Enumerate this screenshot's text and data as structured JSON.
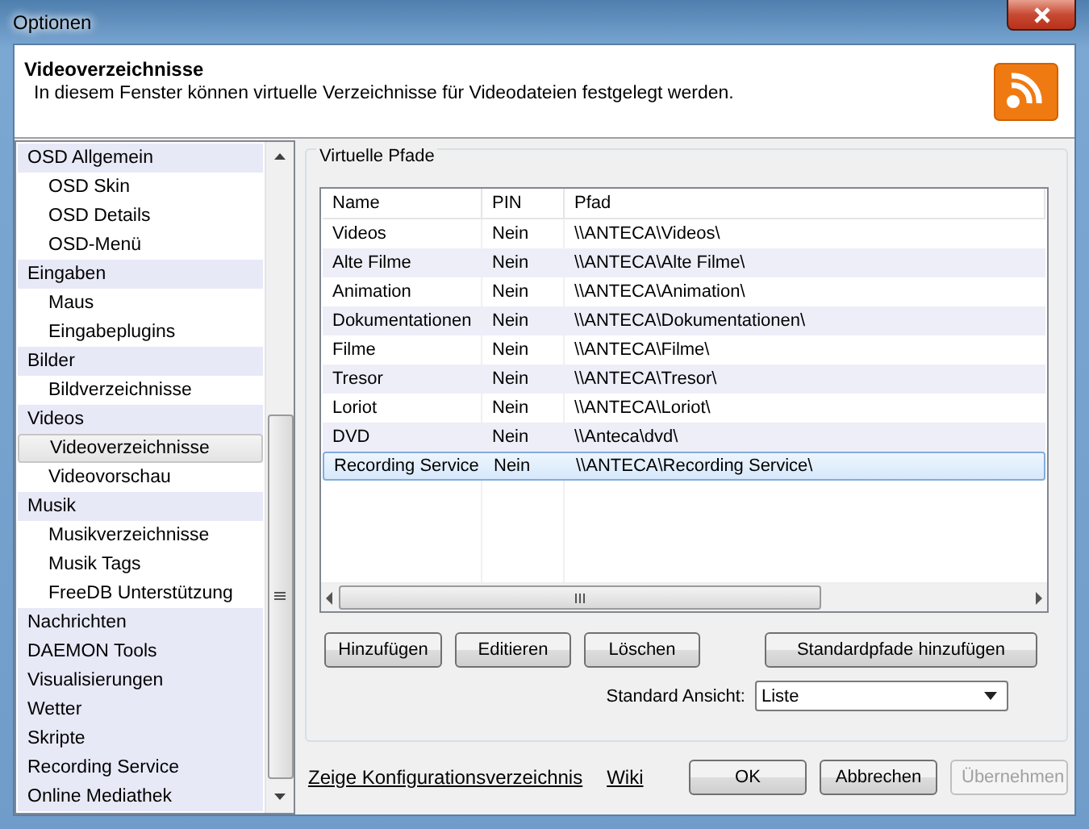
{
  "window": {
    "title": "Optionen"
  },
  "header": {
    "title": "Videoverzeichnisse",
    "description": "In diesem Fenster können virtuelle Verzeichnisse für Videodateien festgelegt werden."
  },
  "sidebar": {
    "items": [
      {
        "label": "OSD Allgemein",
        "selected": false,
        "children": [
          {
            "label": "OSD Skin",
            "selected": false
          },
          {
            "label": "OSD Details",
            "selected": false
          },
          {
            "label": "OSD-Menü",
            "selected": false
          }
        ]
      },
      {
        "label": "Eingaben",
        "selected": false,
        "children": [
          {
            "label": "Maus",
            "selected": false
          },
          {
            "label": "Eingabeplugins",
            "selected": false
          }
        ]
      },
      {
        "label": "Bilder",
        "selected": false,
        "children": [
          {
            "label": "Bildverzeichnisse",
            "selected": false
          }
        ]
      },
      {
        "label": "Videos",
        "selected": false,
        "children": [
          {
            "label": "Videoverzeichnisse",
            "selected": true
          },
          {
            "label": "Videovorschau",
            "selected": false
          }
        ]
      },
      {
        "label": "Musik",
        "selected": false,
        "children": [
          {
            "label": "Musikverzeichnisse",
            "selected": false
          },
          {
            "label": "Musik Tags",
            "selected": false
          },
          {
            "label": "FreeDB Unterstützung",
            "selected": false
          }
        ]
      },
      {
        "label": "Nachrichten",
        "selected": false
      },
      {
        "label": "DAEMON Tools",
        "selected": false
      },
      {
        "label": "Visualisierungen",
        "selected": false
      },
      {
        "label": "Wetter",
        "selected": false
      },
      {
        "label": "Skripte",
        "selected": false
      },
      {
        "label": "Recording Service",
        "selected": false
      },
      {
        "label": "Online Mediathek",
        "selected": false
      }
    ]
  },
  "group": {
    "title": "Virtuelle Pfade",
    "table": {
      "columns": [
        "Name",
        "PIN",
        "Pfad"
      ],
      "rows": [
        {
          "cells": [
            "Videos",
            "Nein",
            "\\\\ANTECA\\Videos\\"
          ],
          "selected": false
        },
        {
          "cells": [
            "Alte Filme",
            "Nein",
            "\\\\ANTECA\\Alte Filme\\"
          ],
          "selected": false
        },
        {
          "cells": [
            "Animation",
            "Nein",
            "\\\\ANTECA\\Animation\\"
          ],
          "selected": false
        },
        {
          "cells": [
            "Dokumentationen",
            "Nein",
            "\\\\ANTECA\\Dokumentationen\\"
          ],
          "selected": false
        },
        {
          "cells": [
            "Filme",
            "Nein",
            "\\\\ANTECA\\Filme\\"
          ],
          "selected": false
        },
        {
          "cells": [
            "Tresor",
            "Nein",
            "\\\\ANTECA\\Tresor\\"
          ],
          "selected": false
        },
        {
          "cells": [
            "Loriot",
            "Nein",
            "\\\\ANTECA\\Loriot\\"
          ],
          "selected": false
        },
        {
          "cells": [
            "DVD",
            "Nein",
            "\\\\Anteca\\dvd\\"
          ],
          "selected": false
        },
        {
          "cells": [
            "Recording Service",
            "Nein",
            "\\\\ANTECA\\Recording Service\\"
          ],
          "selected": true
        }
      ]
    },
    "buttons": [
      "Hinzufügen",
      "Editieren",
      "Löschen",
      "Standardpfade hinzufügen"
    ],
    "view": {
      "label": "Standard Ansicht:",
      "value": "Liste"
    }
  },
  "footer": {
    "links": [
      "Zeige Konfigurationsverzeichnis",
      "Wiki"
    ],
    "buttons": [
      {
        "label": "OK",
        "disabled": false
      },
      {
        "label": "Abbrechen",
        "disabled": false
      },
      {
        "label": "Übernehmen",
        "disabled": true
      }
    ]
  }
}
